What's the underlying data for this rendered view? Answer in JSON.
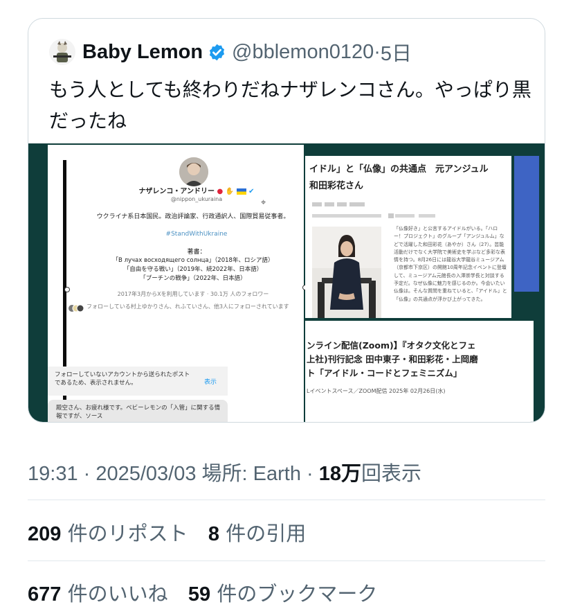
{
  "quoted_tweet": {
    "author_name": "Baby Lemon",
    "handle": "@bblemon0120",
    "separator": "·",
    "time_ago": "5日",
    "text": "もう人としても終わりだねナザレンコさん。やっぱり黒だったね"
  },
  "profile_screenshot": {
    "name": "ナザレンコ・アンドリー",
    "handle": "@nippon_ukuraina",
    "bio": "ウクライナ系日本国民。政治評論家、行政通訳人、国際貿易従事者。",
    "hashtag": "#StandWithUkraine",
    "works_heading": "著書：",
    "works": [
      "「В лучах восходящего солнца」（2018年、ロシア語）",
      "「自由を守る戦い」（2019年、続2022年、日本語）",
      "「プーチンの戦争」（2022年、日本語）"
    ],
    "joined": "2017年3月からXを利用しています · 30.1万 人のフォロワー",
    "followed_by": "フォローしている村上ゆかりさん、れふていさん、他3人にフォローされています",
    "notice_text": "フォローしていないアカウントから送られたポストであるため、表示されません。",
    "notice_button": "表示",
    "dm_text": "殿空さん、お疲れ様です。ベビーレモンの「入管」に関する情報ですが、ソース"
  },
  "article_screenshot": {
    "title_line1": "イドル」と「仏像」の共通点　元アンジュル",
    "title_line2": "和田彩花さん",
    "body": "「仏像好き」と公言するアイドルがいる。「ハロー！プロジェクト」のグループ「アンジュルム」などで活躍した和田彩花（あやか）さん（27）。芸能活動だけでなく大学院で美術史を学ぶなど多彩な表情を持つ。8月26日には龍谷大学龍谷ミュージアム（京都市下京区）の開館10周年記念イベントに登壇して、ミュージアム元館長の入澤崇学長と対談する予定だ。なぜ仏像に魅力を感じるのか。今会いたい仏像は。そんな質問を重ねていると、「アイドル」と「仏像」の共通点が浮かび上がってきた。",
    "event_title": "ンライン配信(Zoom)】『オタク文化とフェ\n上社)刊行記念 田中東子・和田彩花・上岡磨\nト「アイドル・コードとフェミニズム」",
    "event_date": "Lイベントスペース／ZOOM配信 2025年 02月26日(水)"
  },
  "timestamp": {
    "time": "19:31 · 2025/03/03",
    "location": "場所: Earth",
    "separator": "·",
    "views_num": "18万",
    "views_label": "回表示"
  },
  "stats": {
    "reposts_num": "209",
    "reposts_label": "件のリポスト",
    "quotes_num": "8",
    "quotes_label": "件の引用",
    "likes_num": "677",
    "likes_label": "件のいいね",
    "bookmarks_num": "59",
    "bookmarks_label": "件のブックマーク"
  },
  "colors": {
    "verified": "#1d9bf0",
    "secondary_text": "#536471",
    "media_bg": "#0f3d3a",
    "accent_blue": "#3e64c4"
  }
}
